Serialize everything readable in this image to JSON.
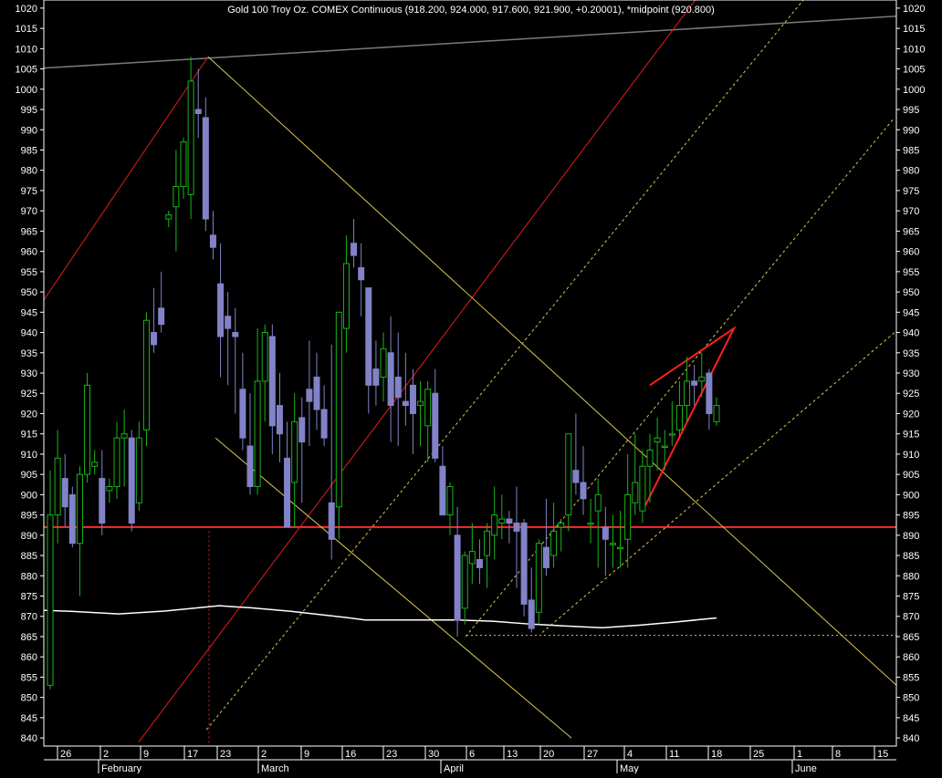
{
  "colors": {
    "background": "#000000",
    "frame": "#ffffff",
    "up_candle": "#19b419",
    "down_candle": "#8282c8",
    "grid": "#b8b800",
    "channel_red": "#dd1f1f",
    "channel_yellow": "#d8c850",
    "moving_average": "#ffffff",
    "resistance": "#7a7a7a",
    "support": "#ff2a2a",
    "text": "#ffffff"
  },
  "chart_data": {
    "type": "candlestick",
    "title": "Gold 100 Troy Oz. COMEX Continuous (918.200, 924.000, 917.600, 921.900, +0.20001), *midpoint (920.800)",
    "ylim": [
      838,
      1022
    ],
    "y_ticks": [
      840,
      845,
      850,
      855,
      860,
      865,
      870,
      875,
      880,
      885,
      890,
      895,
      900,
      905,
      910,
      915,
      920,
      925,
      930,
      935,
      940,
      945,
      950,
      955,
      960,
      965,
      970,
      975,
      980,
      985,
      990,
      995,
      1000,
      1005,
      1010,
      1015,
      1020
    ],
    "x_day_labels": [
      "26",
      "2",
      "9",
      "17",
      "23",
      "2",
      "9",
      "16",
      "23",
      "30",
      "6",
      "13",
      "20",
      "27",
      "4",
      "11",
      "18",
      "25",
      "1",
      "8",
      "15"
    ],
    "x_month_labels": [
      "February",
      "March",
      "April",
      "May",
      "June"
    ],
    "last_close": 921.9,
    "support_level": 892,
    "candles": [
      {
        "o": 853,
        "h": 906,
        "l": 852,
        "c": 895
      },
      {
        "o": 895,
        "h": 916,
        "l": 888,
        "c": 909
      },
      {
        "o": 904,
        "h": 910,
        "l": 892,
        "c": 897
      },
      {
        "o": 900,
        "h": 902,
        "l": 887,
        "c": 888
      },
      {
        "o": 888,
        "h": 907,
        "l": 875,
        "c": 905
      },
      {
        "o": 905,
        "h": 930,
        "l": 903,
        "c": 927
      },
      {
        "o": 907,
        "h": 911,
        "l": 905,
        "c": 908
      },
      {
        "o": 904,
        "h": 911,
        "l": 890,
        "c": 893
      },
      {
        "o": 901,
        "h": 904,
        "l": 898,
        "c": 902
      },
      {
        "o": 902,
        "h": 918,
        "l": 899,
        "c": 914
      },
      {
        "o": 914,
        "h": 921,
        "l": 902,
        "c": 915
      },
      {
        "o": 914,
        "h": 916,
        "l": 891,
        "c": 893
      },
      {
        "o": 898,
        "h": 918,
        "l": 896,
        "c": 914
      },
      {
        "o": 916,
        "h": 945,
        "l": 912,
        "c": 943
      },
      {
        "o": 940,
        "h": 951,
        "l": 935,
        "c": 937
      },
      {
        "o": 946,
        "h": 955,
        "l": 940,
        "c": 942
      },
      {
        "o": 968,
        "h": 970,
        "l": 966,
        "c": 969
      },
      {
        "o": 971,
        "h": 985,
        "l": 960,
        "c": 976
      },
      {
        "o": 976,
        "h": 988,
        "l": 973,
        "c": 987
      },
      {
        "o": 974,
        "h": 1008,
        "l": 968,
        "c": 1002
      },
      {
        "o": 995,
        "h": 1005,
        "l": 988,
        "c": 994
      },
      {
        "o": 993,
        "h": 998,
        "l": 965,
        "c": 968
      },
      {
        "o": 964,
        "h": 970,
        "l": 958,
        "c": 961
      },
      {
        "o": 952,
        "h": 962,
        "l": 929,
        "c": 939
      },
      {
        "o": 944,
        "h": 950,
        "l": 927,
        "c": 941
      },
      {
        "o": 940,
        "h": 946,
        "l": 920,
        "c": 939
      },
      {
        "o": 926,
        "h": 935,
        "l": 911,
        "c": 914
      },
      {
        "o": 912,
        "h": 925,
        "l": 900,
        "c": 902
      },
      {
        "o": 902,
        "h": 941,
        "l": 900,
        "c": 928
      },
      {
        "o": 928,
        "h": 942,
        "l": 918,
        "c": 940
      },
      {
        "o": 939,
        "h": 942,
        "l": 910,
        "c": 917
      },
      {
        "o": 922,
        "h": 930,
        "l": 908,
        "c": 915
      },
      {
        "o": 909,
        "h": 918,
        "l": 902,
        "c": 892
      },
      {
        "o": 903,
        "h": 925,
        "l": 892,
        "c": 918
      },
      {
        "o": 919,
        "h": 924,
        "l": 898,
        "c": 913
      },
      {
        "o": 926,
        "h": 938,
        "l": 912,
        "c": 923
      },
      {
        "o": 929,
        "h": 935,
        "l": 916,
        "c": 921
      },
      {
        "o": 921,
        "h": 927,
        "l": 912,
        "c": 914
      },
      {
        "o": 898,
        "h": 937,
        "l": 884,
        "c": 889
      },
      {
        "o": 897,
        "h": 945,
        "l": 889,
        "c": 945
      },
      {
        "o": 941,
        "h": 964,
        "l": 935,
        "c": 957
      },
      {
        "o": 962,
        "h": 968,
        "l": 956,
        "c": 959
      },
      {
        "o": 956,
        "h": 962,
        "l": 944,
        "c": 953
      },
      {
        "o": 951,
        "h": 947,
        "l": 920,
        "c": 927
      },
      {
        "o": 931,
        "h": 938,
        "l": 922,
        "c": 927
      },
      {
        "o": 929,
        "h": 940,
        "l": 923,
        "c": 936
      },
      {
        "o": 935,
        "h": 944,
        "l": 913,
        "c": 922
      },
      {
        "o": 929,
        "h": 940,
        "l": 912,
        "c": 924
      },
      {
        "o": 923,
        "h": 935,
        "l": 917,
        "c": 922
      },
      {
        "o": 927,
        "h": 931,
        "l": 910,
        "c": 920
      },
      {
        "o": 922,
        "h": 928,
        "l": 912,
        "c": 923
      },
      {
        "o": 917,
        "h": 928,
        "l": 908,
        "c": 926
      },
      {
        "o": 925,
        "h": 931,
        "l": 908,
        "c": 909
      },
      {
        "o": 907,
        "h": 912,
        "l": 895,
        "c": 895
      },
      {
        "o": 895,
        "h": 903,
        "l": 890,
        "c": 902
      },
      {
        "o": 890,
        "h": 897,
        "l": 865,
        "c": 869
      },
      {
        "o": 872,
        "h": 886,
        "l": 868,
        "c": 885
      },
      {
        "o": 883,
        "h": 893,
        "l": 878,
        "c": 886
      },
      {
        "o": 884,
        "h": 889,
        "l": 878,
        "c": 882
      },
      {
        "o": 885,
        "h": 893,
        "l": 877,
        "c": 891
      },
      {
        "o": 890,
        "h": 902,
        "l": 884,
        "c": 895
      },
      {
        "o": 893,
        "h": 900,
        "l": 889,
        "c": 894
      },
      {
        "o": 894,
        "h": 896,
        "l": 888,
        "c": 893
      },
      {
        "o": 893,
        "h": 902,
        "l": 877,
        "c": 891
      },
      {
        "o": 893,
        "h": 894,
        "l": 870,
        "c": 873
      },
      {
        "o": 874,
        "h": 882,
        "l": 866,
        "c": 867
      },
      {
        "o": 871,
        "h": 889,
        "l": 868,
        "c": 888
      },
      {
        "o": 887,
        "h": 899,
        "l": 880,
        "c": 882
      },
      {
        "o": 885,
        "h": 898,
        "l": 882,
        "c": 891
      },
      {
        "o": 892,
        "h": 894,
        "l": 886,
        "c": 893
      },
      {
        "o": 895,
        "h": 915,
        "l": 891,
        "c": 915
      },
      {
        "o": 906,
        "h": 920,
        "l": 900,
        "c": 903
      },
      {
        "o": 903,
        "h": 912,
        "l": 895,
        "c": 899
      },
      {
        "o": 893,
        "h": 899,
        "l": 888,
        "c": 893
      },
      {
        "o": 896,
        "h": 904,
        "l": 882,
        "c": 900
      },
      {
        "o": 892,
        "h": 897,
        "l": 880,
        "c": 889
      },
      {
        "o": 888,
        "h": 895,
        "l": 882,
        "c": 888
      },
      {
        "o": 887,
        "h": 896,
        "l": 882,
        "c": 887
      },
      {
        "o": 889,
        "h": 910,
        "l": 882,
        "c": 900
      },
      {
        "o": 898,
        "h": 915,
        "l": 895,
        "c": 903
      },
      {
        "o": 896,
        "h": 911,
        "l": 893,
        "c": 907
      },
      {
        "o": 907,
        "h": 915,
        "l": 898,
        "c": 911
      },
      {
        "o": 913,
        "h": 919,
        "l": 906,
        "c": 914
      },
      {
        "o": 912,
        "h": 916,
        "l": 906,
        "c": 912
      },
      {
        "o": 915,
        "h": 923,
        "l": 912,
        "c": 915
      },
      {
        "o": 916,
        "h": 928,
        "l": 914,
        "c": 922
      },
      {
        "o": 922,
        "h": 934,
        "l": 918,
        "c": 928
      },
      {
        "o": 928,
        "h": 932,
        "l": 922,
        "c": 927
      },
      {
        "o": 928,
        "h": 935,
        "l": 924,
        "c": 929
      },
      {
        "o": 930,
        "h": 931,
        "l": 916,
        "c": 920
      },
      {
        "o": 918,
        "h": 924,
        "l": 917,
        "c": 922
      }
    ]
  }
}
